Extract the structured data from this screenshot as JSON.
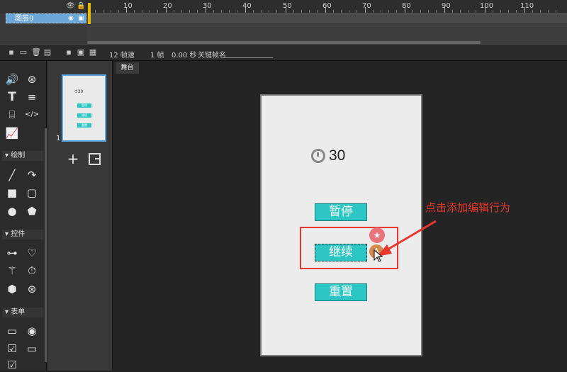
{
  "timeline": {
    "layer_name": "图层0",
    "ruler_labels": [
      "10",
      "20",
      "30",
      "40",
      "50",
      "60",
      "70",
      "80",
      "90",
      "100",
      "110"
    ]
  },
  "statusbar": {
    "fps": "12 帧速",
    "frame": "1 帧",
    "time": "0.00 秒",
    "keyframe_label": "关键帧名"
  },
  "toolbox": {
    "sections": [
      "绘制",
      "控件",
      "表单"
    ]
  },
  "pages": {
    "page_number": "1",
    "thumb_timer": "30",
    "thumb_buttons": [
      "暂停",
      "继续",
      "重置"
    ]
  },
  "stage": {
    "tab_label": "舞台",
    "timer_value": "30",
    "buttons": [
      "暂停",
      "继续",
      "重置"
    ],
    "annotation": "点击添加编辑行为",
    "accent": "#2cc7c4",
    "highlight_color": "#e8382e"
  }
}
